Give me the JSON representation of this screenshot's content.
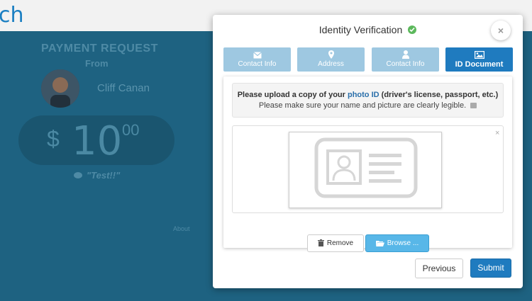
{
  "background": {
    "logo": "ch",
    "title": "PAYMENT REQUEST",
    "from_label": "From",
    "sender_name": "Cliff Canan",
    "currency_symbol": "$",
    "amount_whole": "10",
    "amount_cents": "00",
    "note": "\"Test!!\"",
    "about_label": "About"
  },
  "modal": {
    "title": "Identity Verification",
    "close_label": "×",
    "steps": [
      {
        "label": "Contact Info",
        "icon": "envelope-icon",
        "active": false
      },
      {
        "label": "Address",
        "icon": "map-marker-icon",
        "active": false
      },
      {
        "label": "Contact Info",
        "icon": "user-icon",
        "active": false
      },
      {
        "label": "ID Document",
        "icon": "image-icon",
        "active": true
      }
    ],
    "upload": {
      "instruction_prefix": "Please upload a copy of your ",
      "instruction_link": "photo ID",
      "instruction_suffix": " (driver's license, passport, etc.)",
      "hint": "Please make sure your name and picture are clearly legible.",
      "dropzone_close": "×"
    },
    "buttons": {
      "remove": "Remove",
      "browse": "Browse ...",
      "previous": "Previous",
      "submit": "Submit"
    }
  },
  "colors": {
    "accent": "#1f7bbf",
    "step_inactive": "#9ec8e1",
    "browse": "#58b7e8",
    "success": "#5cb85c"
  }
}
